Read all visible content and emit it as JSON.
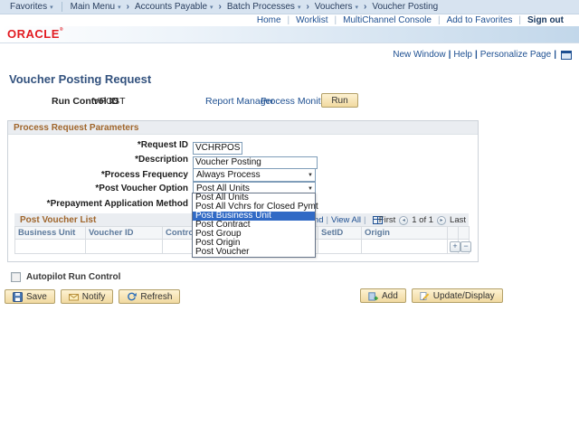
{
  "colors": {
    "oracle_red": "#e21b21",
    "link_blue": "#1d4f91",
    "section_heading_orange": "#a0662c",
    "selection_highlight": "#316ac5",
    "button_tan": "#f1d9a0",
    "breadcrumb_bar": "#d7e3f0"
  },
  "crumbbar": {
    "favorites": "Favorites",
    "main_menu": "Main Menu",
    "crumbs": [
      "Accounts Payable",
      "Batch Processes",
      "Vouchers",
      "Voucher Posting"
    ]
  },
  "header_links": [
    "Home",
    "Worklist",
    "MultiChannel Console",
    "Add to Favorites",
    "Sign out"
  ],
  "brand": "ORACLE",
  "page_links": [
    "New Window",
    "Help",
    "Personalize Page"
  ],
  "page": {
    "title": "Voucher Posting Request",
    "run_control_label": "Run Control ID",
    "run_control_value": "VPOST",
    "report_manager": "Report Manager",
    "process_monitor": "Process Monitor",
    "run_button": "Run"
  },
  "params": {
    "section_title": "Process Request Parameters",
    "fields": [
      {
        "label": "*Request ID",
        "value": "VCHRPOST"
      },
      {
        "label": "*Description",
        "value": "Voucher Posting"
      },
      {
        "label": "*Process Frequency",
        "value": "Always Process"
      },
      {
        "label": "*Post Voucher Option",
        "value": "Post All Units"
      },
      {
        "label": "*Prepayment Application Method",
        "value": ""
      }
    ]
  },
  "dropdown": {
    "options": [
      "Post All Units",
      "Post All Vchrs for Closed Pymt",
      "Post Business Unit",
      "Post Contract",
      "Post Group",
      "Post Origin",
      "Post Voucher"
    ],
    "selected": "Post Business Unit"
  },
  "grid": {
    "title": "Post Voucher List",
    "find_label": "Find",
    "view_all_label": "View All",
    "pager_first": "First",
    "pager_position": "1 of 1",
    "pager_last": "Last",
    "columns": [
      "Business Unit",
      "Voucher ID",
      "Control Group ID",
      "SetID",
      "Origin"
    ]
  },
  "footer": {
    "autopilot_label": "Autopilot Run Control",
    "save_label": "Save",
    "notify_label": "Notify",
    "refresh_label": "Refresh",
    "add_label": "Add",
    "update_display_label": "Update/Display"
  }
}
